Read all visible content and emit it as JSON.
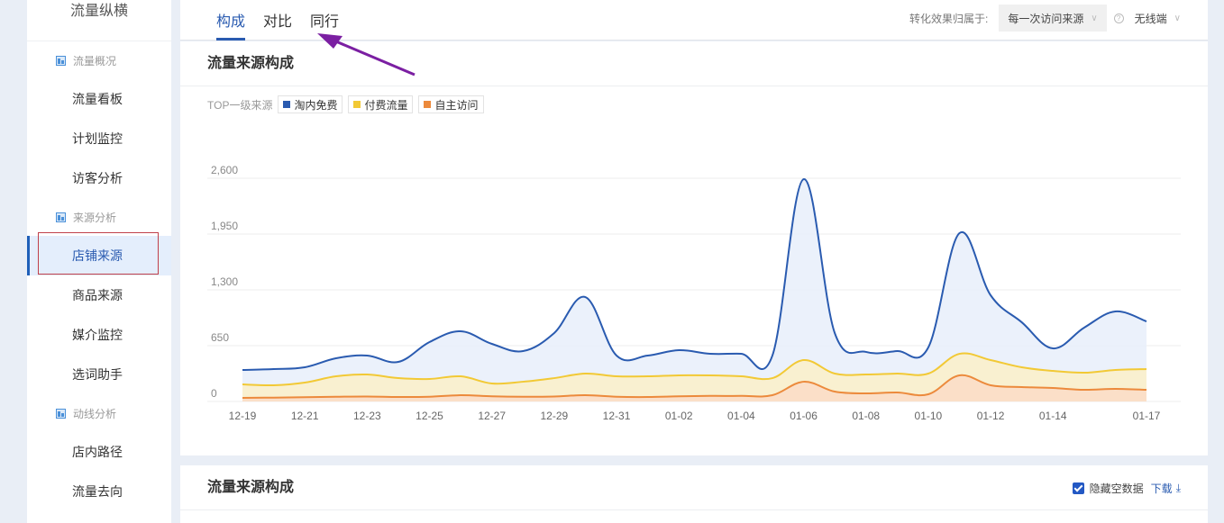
{
  "sidebar": {
    "title": "流量纵横",
    "groups": [
      {
        "label": "流量概况",
        "items": [
          "流量看板",
          "计划监控",
          "访客分析"
        ]
      },
      {
        "label": "来源分析",
        "items": [
          "店铺来源",
          "商品来源",
          "媒介监控",
          "选词助手"
        ]
      },
      {
        "label": "动线分析",
        "items": [
          "店内路径",
          "流量去向"
        ]
      }
    ],
    "active_item": "店铺来源"
  },
  "tabs": [
    {
      "label": "构成",
      "active": true
    },
    {
      "label": "对比",
      "active": false
    },
    {
      "label": "同行",
      "active": false
    }
  ],
  "toolbar": {
    "attribution_label": "转化效果归属于:",
    "attribution_value": "每一次访问来源",
    "help_icon": "?",
    "device_value": "无线端"
  },
  "card1": {
    "title": "流量来源构成",
    "legend_prefix": "TOP一级来源"
  },
  "card2": {
    "title": "流量来源构成",
    "hide_empty_label": "隐藏空数据",
    "hide_empty_checked": true,
    "download_label": "下载"
  },
  "chart_data": {
    "type": "area",
    "title": "",
    "xlabel": "",
    "ylabel": "",
    "ylim": [
      0,
      2600
    ],
    "yticks": [
      0,
      650,
      1300,
      1950,
      2600
    ],
    "ytick_labels": [
      "0",
      "650",
      "1,300",
      "1,950",
      "2,600"
    ],
    "grid": true,
    "legend": "top-left",
    "categories": [
      "12-19",
      "12-20",
      "12-21",
      "12-22",
      "12-23",
      "12-24",
      "12-25",
      "12-26",
      "12-27",
      "12-28",
      "12-29",
      "12-30",
      "12-31",
      "01-01",
      "01-02",
      "01-03",
      "01-04",
      "01-05",
      "01-06",
      "01-07",
      "01-08",
      "01-09",
      "01-10",
      "01-11",
      "01-12",
      "01-13",
      "01-14",
      "01-15",
      "01-16",
      "01-17"
    ],
    "xtick_labels": [
      "12-19",
      "12-21",
      "12-23",
      "12-25",
      "12-27",
      "12-29",
      "12-31",
      "01-02",
      "01-04",
      "01-06",
      "01-08",
      "01-10",
      "01-12",
      "01-14",
      "01-17"
    ],
    "series": [
      {
        "name": "淘内免费",
        "color": "#2a5bb0",
        "fill": "#e8eefa",
        "values": [
          367,
          377,
          398,
          503,
          535,
          461,
          692,
          818,
          671,
          587,
          797,
          1216,
          535,
          535,
          598,
          556,
          556,
          535,
          2589,
          797,
          577,
          587,
          629,
          1960,
          1237,
          922,
          618,
          860,
          1048,
          933
        ]
      },
      {
        "name": "付费流量",
        "color": "#f2c935",
        "fill": "#fcf0c8",
        "values": [
          199,
          189,
          220,
          293,
          314,
          272,
          262,
          293,
          210,
          230,
          272,
          325,
          293,
          293,
          304,
          304,
          293,
          272,
          482,
          325,
          314,
          325,
          325,
          555,
          482,
          398,
          356,
          335,
          367,
          377
        ]
      },
      {
        "name": "自主访问",
        "color": "#ec8a3c",
        "fill": "#fbdcc7",
        "values": [
          42,
          45,
          50,
          55,
          58,
          52,
          55,
          73,
          60,
          55,
          58,
          73,
          55,
          52,
          60,
          65,
          65,
          73,
          230,
          115,
          94,
          105,
          84,
          304,
          189,
          168,
          157,
          136,
          147,
          136
        ]
      }
    ]
  }
}
